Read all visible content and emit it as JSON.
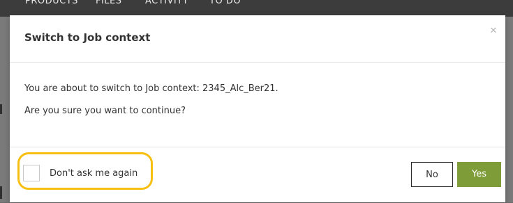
{
  "background_nav": {
    "items": [
      "PRODUCTS",
      "FILES",
      "ACTIVITY",
      "TO DO"
    ]
  },
  "modal": {
    "title": "Switch to Job context",
    "close_icon": "close-icon",
    "body": {
      "line1": "You are about to switch to Job context: 2345_Alc_Ber21.",
      "line2": "Are you sure you want to continue?"
    },
    "footer": {
      "dont_ask_label": "Don't ask me again",
      "dont_ask_checked": false,
      "no_label": "No",
      "yes_label": "Yes"
    }
  },
  "colors": {
    "primary_button": "#7e9c37",
    "highlight": "#f6bf12",
    "overlay": "#6b6b6b"
  }
}
